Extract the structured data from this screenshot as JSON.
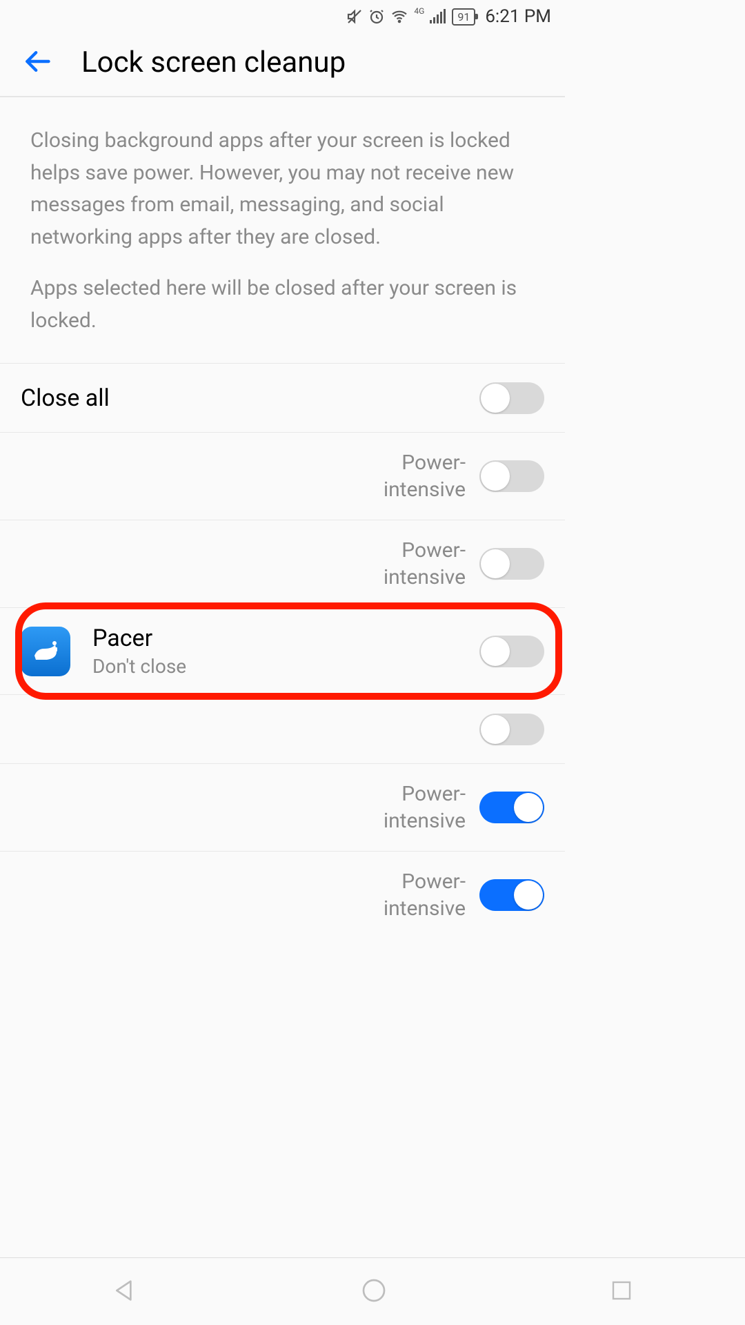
{
  "status_bar": {
    "battery_level": "91",
    "time": "6:21 PM",
    "network_label": "4G"
  },
  "header": {
    "title": "Lock screen cleanup"
  },
  "description": {
    "p1": "Closing background apps after your screen is locked helps save power. However, you may not receive new messages from email, messaging, and social networking apps after they are closed.",
    "p2": "Apps selected here will be closed after your screen is locked."
  },
  "close_all": {
    "label": "Close all",
    "on": false
  },
  "rows": [
    {
      "name": "",
      "sub": "",
      "right_label": "Power-intensive",
      "on": false,
      "has_icon": false,
      "highlighted": false
    },
    {
      "name": "",
      "sub": "",
      "right_label": "Power-intensive",
      "on": false,
      "has_icon": false,
      "highlighted": false
    },
    {
      "name": "Pacer",
      "sub": "Don't close",
      "right_label": "",
      "on": false,
      "has_icon": true,
      "icon": "pacer",
      "highlighted": true
    },
    {
      "name": "",
      "sub": "",
      "right_label": "",
      "on": false,
      "has_icon": false,
      "highlighted": false
    },
    {
      "name": "",
      "sub": "",
      "right_label": "Power-intensive",
      "on": true,
      "has_icon": false,
      "highlighted": false
    },
    {
      "name": "",
      "sub": "",
      "right_label": "Power-intensive",
      "on": true,
      "has_icon": false,
      "highlighted": false
    }
  ]
}
